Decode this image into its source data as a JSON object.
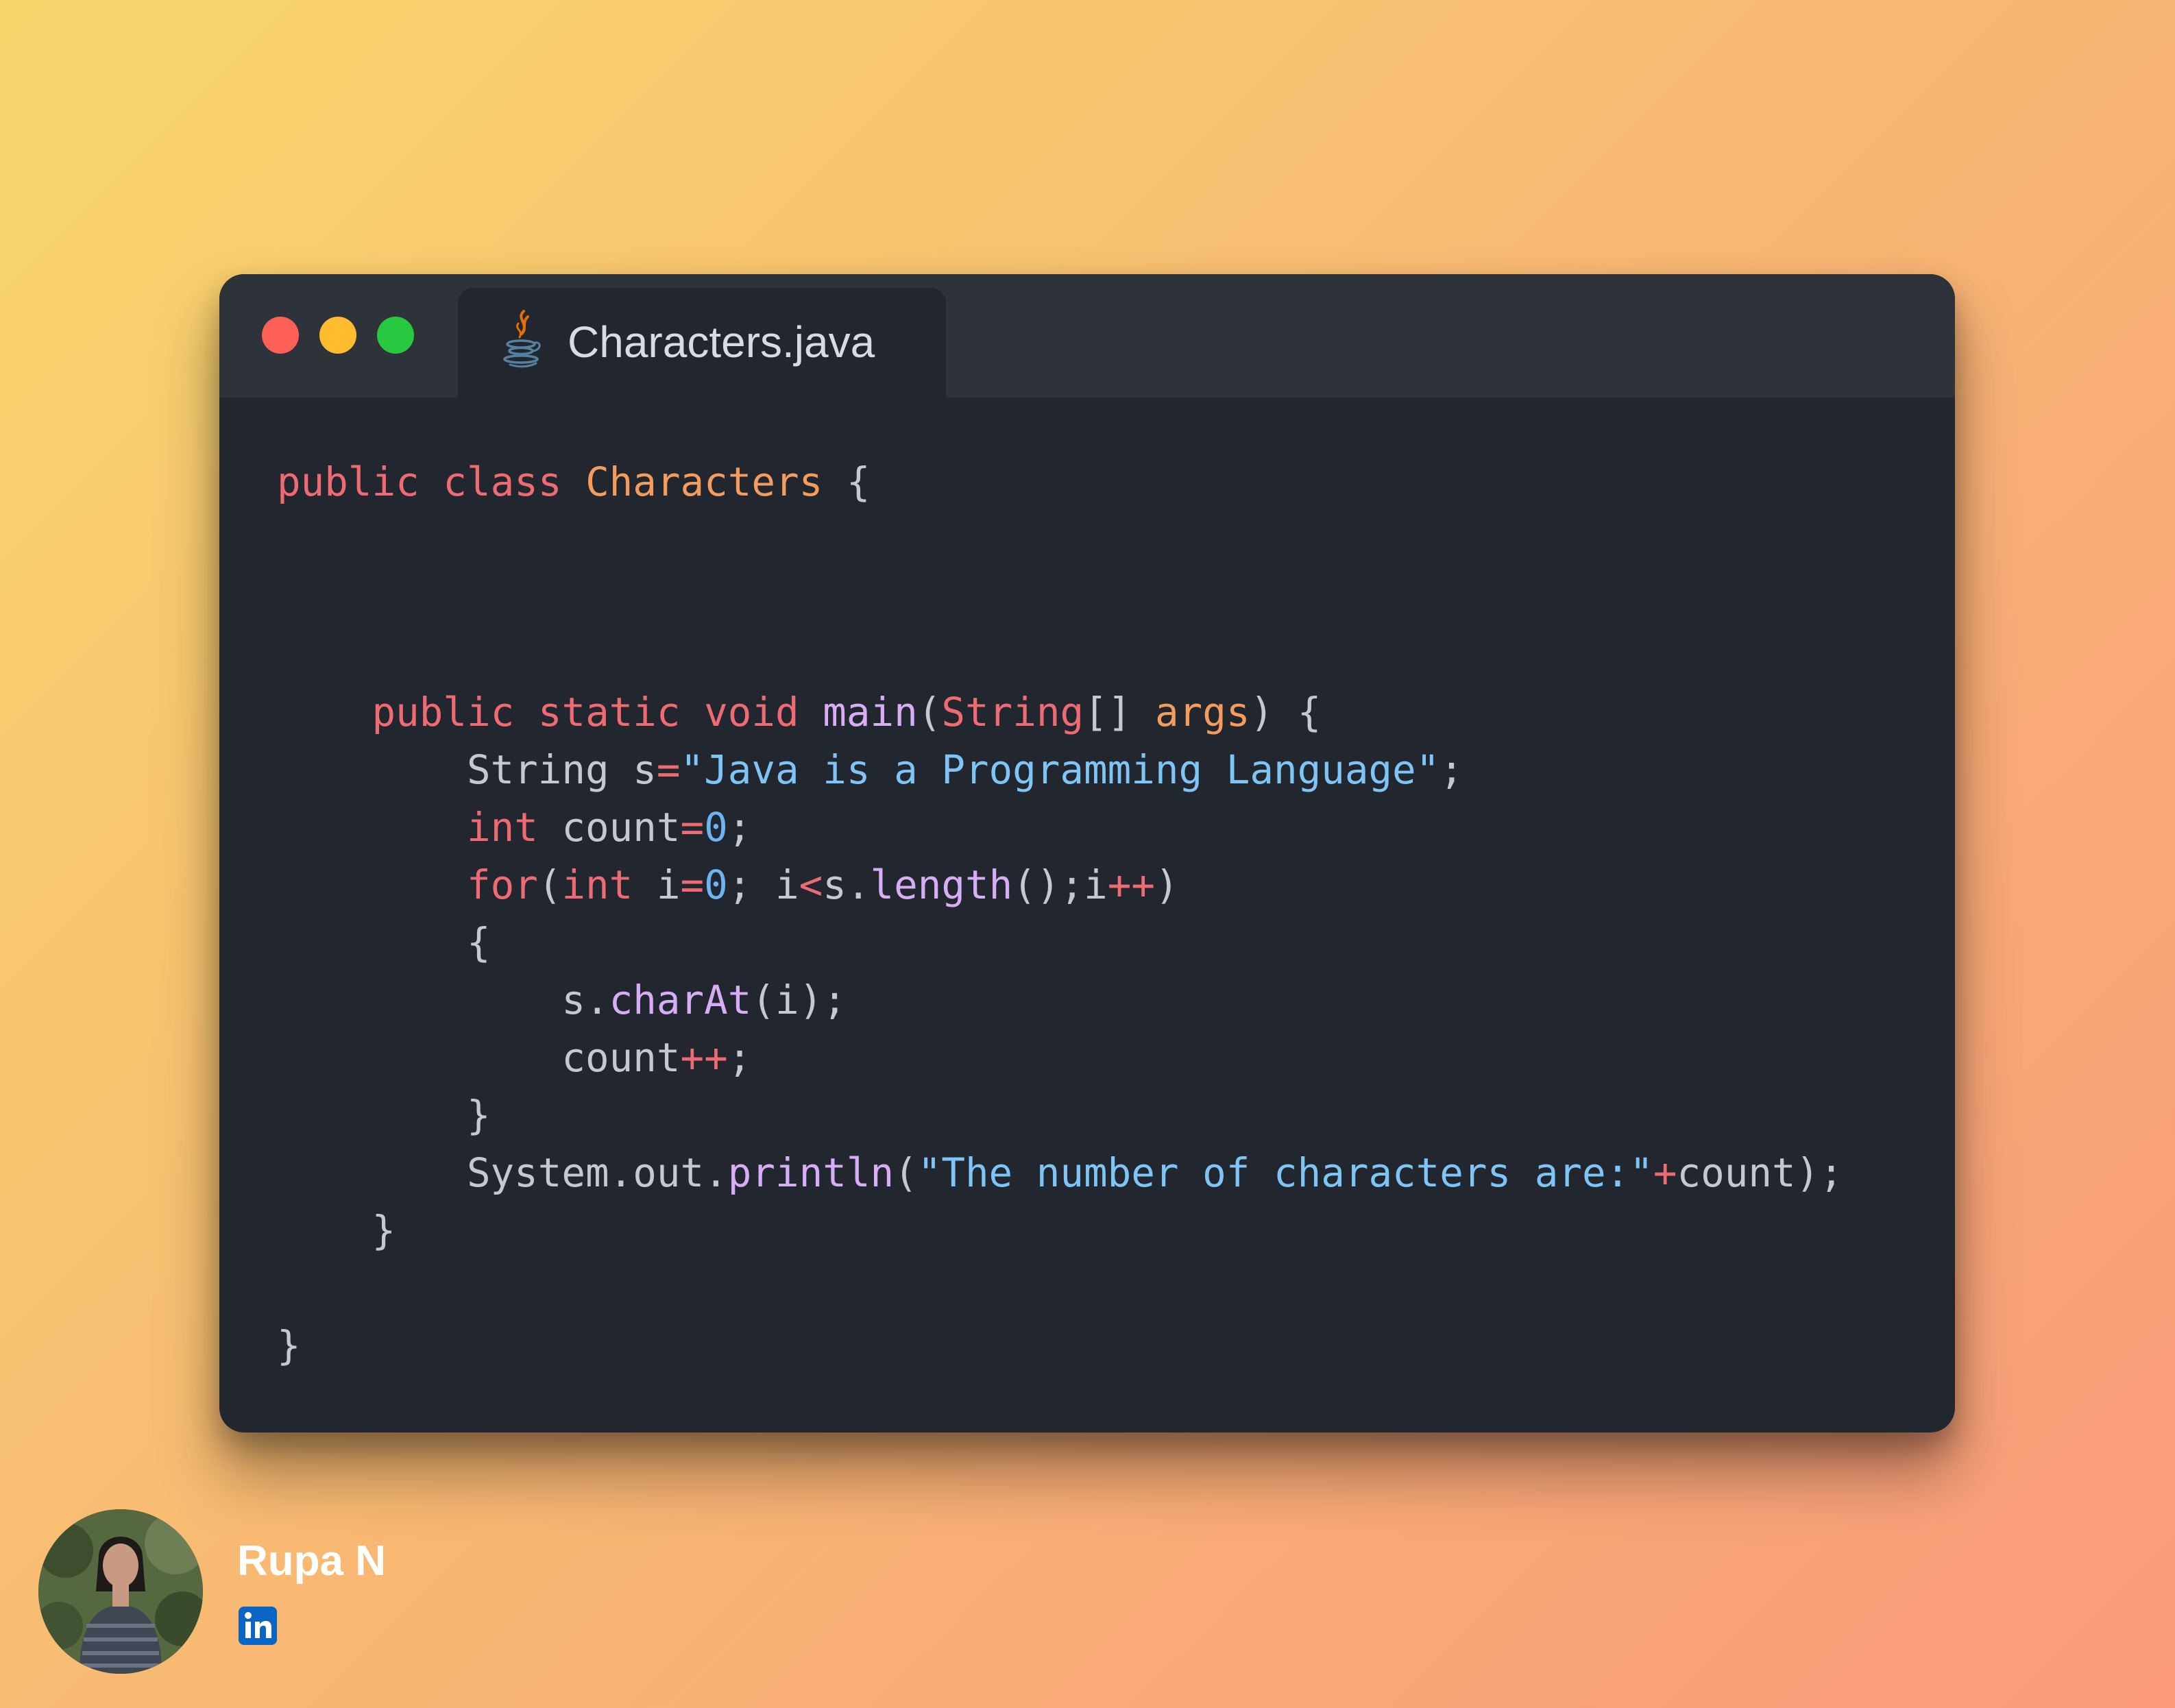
{
  "window": {
    "traffic_lights": [
      {
        "name": "close-dot",
        "color": "#fe5f57"
      },
      {
        "name": "minimize-dot",
        "color": "#febc2e"
      },
      {
        "name": "maximize-dot",
        "color": "#28c840"
      }
    ],
    "tab": {
      "icon": "java-icon",
      "title": "Characters.java"
    }
  },
  "code": {
    "language": "java",
    "lines": [
      [
        {
          "t": "public",
          "c": "kw"
        },
        {
          "t": " ",
          "c": "plain"
        },
        {
          "t": "class",
          "c": "kw"
        },
        {
          "t": " ",
          "c": "plain"
        },
        {
          "t": "Characters",
          "c": "cls"
        },
        {
          "t": " {",
          "c": "plain"
        }
      ],
      [],
      [],
      [],
      [
        {
          "t": "    ",
          "c": "plain"
        },
        {
          "t": "public",
          "c": "kw"
        },
        {
          "t": " ",
          "c": "plain"
        },
        {
          "t": "static",
          "c": "kw"
        },
        {
          "t": " ",
          "c": "plain"
        },
        {
          "t": "void",
          "c": "kw"
        },
        {
          "t": " ",
          "c": "plain"
        },
        {
          "t": "main",
          "c": "fn"
        },
        {
          "t": "(",
          "c": "plain"
        },
        {
          "t": "String",
          "c": "kw"
        },
        {
          "t": "[] ",
          "c": "plain"
        },
        {
          "t": "args",
          "c": "param"
        },
        {
          "t": ") {",
          "c": "plain"
        }
      ],
      [
        {
          "t": "        String s",
          "c": "plain"
        },
        {
          "t": "=",
          "c": "op"
        },
        {
          "t": "\"Java is a Programming Language\"",
          "c": "str"
        },
        {
          "t": ";",
          "c": "plain"
        }
      ],
      [
        {
          "t": "        ",
          "c": "plain"
        },
        {
          "t": "int",
          "c": "kw"
        },
        {
          "t": " count",
          "c": "plain"
        },
        {
          "t": "=",
          "c": "op"
        },
        {
          "t": "0",
          "c": "num"
        },
        {
          "t": ";",
          "c": "plain"
        }
      ],
      [
        {
          "t": "        ",
          "c": "plain"
        },
        {
          "t": "for",
          "c": "kw"
        },
        {
          "t": "(",
          "c": "plain"
        },
        {
          "t": "int",
          "c": "kw"
        },
        {
          "t": " i",
          "c": "plain"
        },
        {
          "t": "=",
          "c": "op"
        },
        {
          "t": "0",
          "c": "num"
        },
        {
          "t": "; i",
          "c": "plain"
        },
        {
          "t": "<",
          "c": "op"
        },
        {
          "t": "s.",
          "c": "plain"
        },
        {
          "t": "length",
          "c": "fn"
        },
        {
          "t": "();i",
          "c": "plain"
        },
        {
          "t": "++",
          "c": "op"
        },
        {
          "t": ")",
          "c": "plain"
        }
      ],
      [
        {
          "t": "        {",
          "c": "plain"
        }
      ],
      [
        {
          "t": "            s.",
          "c": "plain"
        },
        {
          "t": "charAt",
          "c": "fn"
        },
        {
          "t": "(i);",
          "c": "plain"
        }
      ],
      [
        {
          "t": "            count",
          "c": "plain"
        },
        {
          "t": "++",
          "c": "op"
        },
        {
          "t": ";",
          "c": "plain"
        }
      ],
      [
        {
          "t": "        }",
          "c": "plain"
        }
      ],
      [
        {
          "t": "        System.out.",
          "c": "plain"
        },
        {
          "t": "println",
          "c": "fn"
        },
        {
          "t": "(",
          "c": "plain"
        },
        {
          "t": "\"The number of characters are:\"",
          "c": "str"
        },
        {
          "t": "+",
          "c": "op"
        },
        {
          "t": "count);",
          "c": "plain"
        }
      ],
      [
        {
          "t": "    }",
          "c": "plain"
        }
      ],
      [],
      [
        {
          "t": "}",
          "c": "plain"
        }
      ]
    ]
  },
  "author": {
    "name": "Rupa N",
    "avatar": "profile-photo",
    "social_icon": "linkedin-icon"
  }
}
